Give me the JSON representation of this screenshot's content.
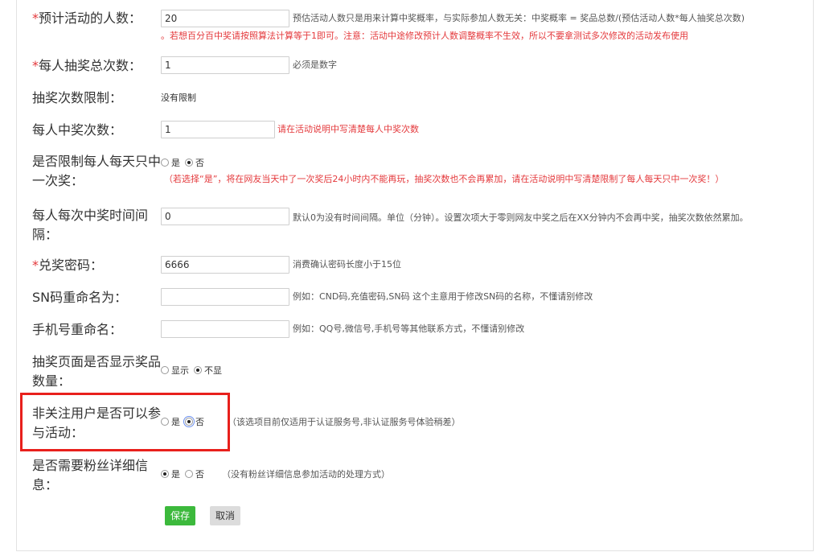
{
  "rows": {
    "participants": {
      "label_prefix": "*",
      "label": "预计活动的人数：",
      "value": "20",
      "hint": "预估活动人数只是用来计算中奖概率，与实际参加人数无关：中奖概率 = 奖品总数/(预估活动人数*每人抽奖总次数)",
      "warning": "。若想百分百中奖请按照算法计算等于1即可。注意：活动中途修改预计人数调整概率不生效，所以不要拿测试多次修改的活动发布使用"
    },
    "draw_total": {
      "label_prefix": "*",
      "label": "每人抽奖总次数：",
      "value": "1",
      "hint": "必须是数字"
    },
    "draw_limit": {
      "label": "抽奖次数限制：",
      "value": "没有限制"
    },
    "wins_per_person": {
      "label": "每人中奖次数：",
      "value": "1",
      "hint": "请在活动说明中写清楚每人中奖次数"
    },
    "daily_limit": {
      "label": "是否限制每人每天只中一次奖：",
      "option_yes": "是",
      "option_no": "否",
      "selected": "否",
      "hint": "（若选择“是”，将在网友当天中了一次奖后24小时内不能再玩，抽奖次数也不会再累加，请在活动说明中写清楚限制了每人每天只中一次奖！）"
    },
    "interval": {
      "label": "每人每次中奖时间间隔：",
      "value": "0",
      "hint": "默认0为没有时间间隔。单位（分钟）。设置次项大于零则网友中奖之后在XX分钟内不会再中奖，抽奖次数依然累加。"
    },
    "redeem_password": {
      "label_prefix": "*",
      "label": "兑奖密码：",
      "value": "6666",
      "hint": "消费确认密码长度小于15位"
    },
    "sn_rename": {
      "label": "SN码重命名为：",
      "value": "",
      "hint": "例如：CND码,充值密码,SN码 这个主意用于修改SN码的名称，不懂请别修改"
    },
    "phone_rename": {
      "label": "手机号重命名：",
      "value": "",
      "hint": "例如：QQ号,微信号,手机号等其他联系方式，不懂请别修改"
    },
    "show_prize_count": {
      "label": "抽奖页面是否显示奖品数量：",
      "option_yes": "显示",
      "option_no": "不显",
      "selected": "不显"
    },
    "non_follower": {
      "label": "非关注用户是否可以参与活动：",
      "option_yes": "是",
      "option_no": "否",
      "selected": "否",
      "hint": "（该选项目前仅适用于认证服务号,非认证服务号体验稍差）"
    },
    "fan_details": {
      "label": "是否需要粉丝详细信息：",
      "option_yes": "是",
      "option_no": "否",
      "selected": "是",
      "hint": "（没有粉丝详细信息参加活动的处理方式）"
    }
  },
  "buttons": {
    "save": "保存",
    "cancel": "取消"
  },
  "colors": {
    "required": "#e4393c",
    "highlight": "#e8201c",
    "save_bg": "#3cb93c",
    "cancel_bg": "#dcdcdc"
  }
}
